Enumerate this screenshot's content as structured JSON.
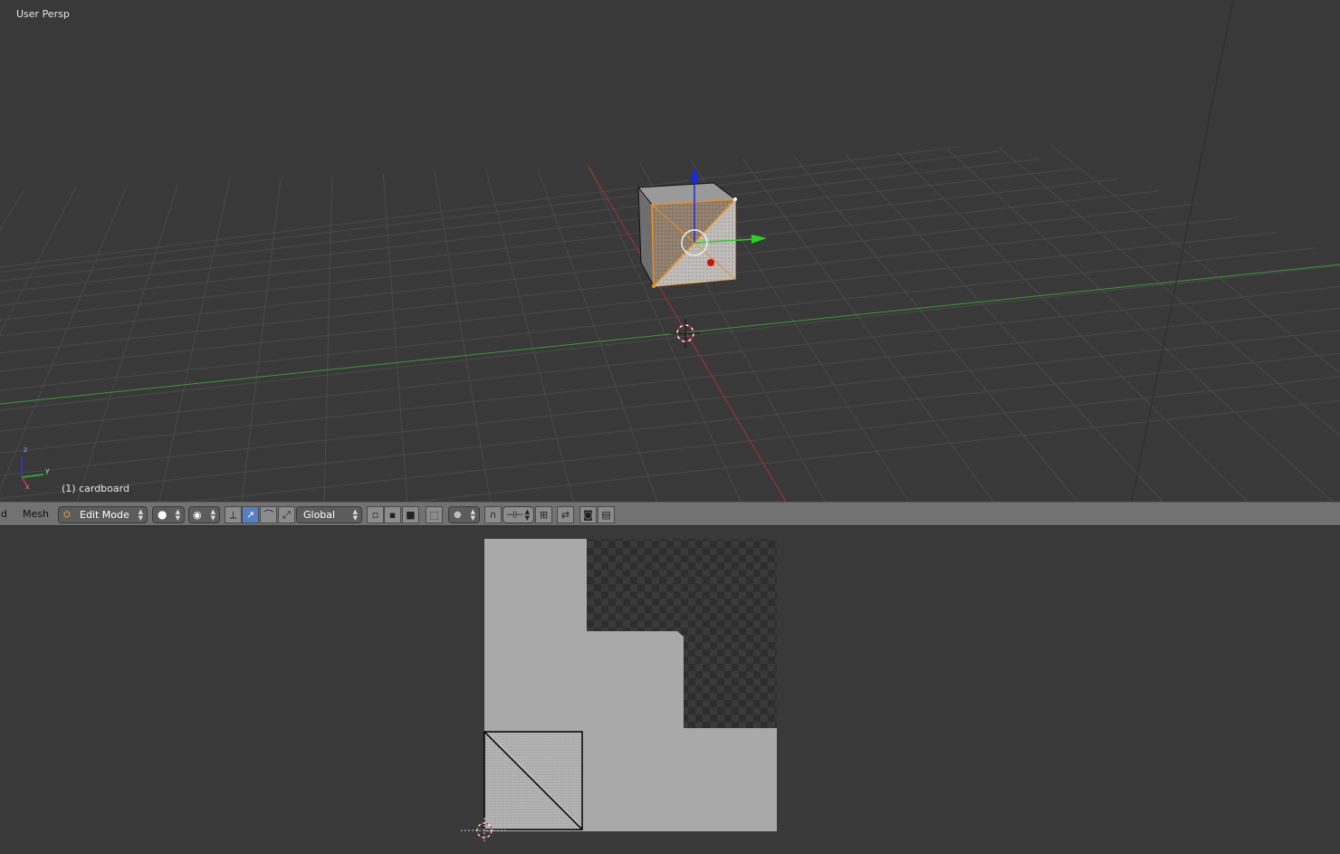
{
  "viewport": {
    "view_label": "User Persp",
    "object_label": "(1) cardboard",
    "axis_labels": {
      "z": "z",
      "y": "y",
      "x": "x"
    },
    "colors": {
      "x_axis": "#a83232",
      "y_axis": "#3a9a3a",
      "selection": "#e8922a",
      "background": "#393939"
    }
  },
  "header": {
    "menu_partial": "d",
    "menu_mesh": "Mesh",
    "mode": "Edit Mode",
    "pivot_icon": "pivot-circle-icon",
    "transform_orientation": "Global",
    "icons": [
      "viewport-shading-icon",
      "pivot-icon",
      "manipulator-translate-icon",
      "manipulator-rotate-icon",
      "manipulator-scale-icon",
      "vertex-select-icon",
      "edge-select-icon",
      "face-select-icon",
      "limit-selection-icon",
      "proportional-edit-icon",
      "snap-icon",
      "snap-target-icon",
      "opengl-render-icon",
      "render-animation-icon"
    ]
  },
  "uv_editor": {
    "colors": {
      "texture": "#a9a9a9",
      "checker_dark": "#2e2e2e",
      "checker_light": "#3a3a3a",
      "uv_face": "#b5b5b5"
    }
  }
}
